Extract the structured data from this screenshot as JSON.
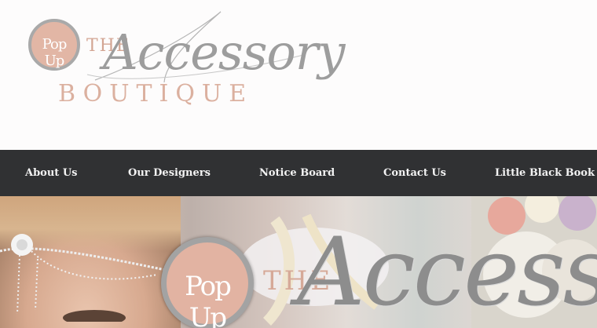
{
  "logo": {
    "badge_text": "Pop Up",
    "the": "THE",
    "script": "Accessory",
    "boutique": "BOUTIQUE"
  },
  "nav": {
    "items": [
      {
        "label": "About Us"
      },
      {
        "label": "Our Designers"
      },
      {
        "label": "Notice Board"
      },
      {
        "label": "Contact Us"
      },
      {
        "label": "Little Black Book"
      }
    ]
  },
  "hero": {
    "badge_text": "Pop Up",
    "the": "THE",
    "script": "Accessory"
  },
  "colors": {
    "nav_bg": "#303133",
    "brand_pink": "#e2b6a5",
    "brand_gray": "#a9a9a9"
  }
}
